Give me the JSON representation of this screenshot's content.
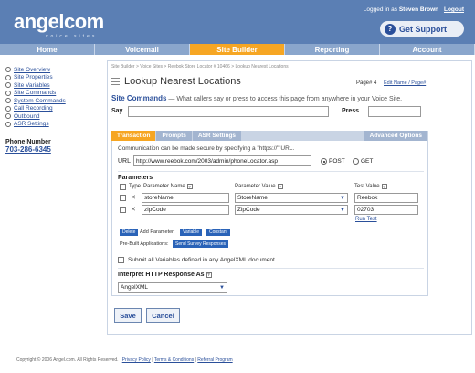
{
  "header": {
    "logo": "angelcom",
    "logo_sub": "voice sites",
    "logged_prefix": "Logged in as",
    "user": "Steven Brown",
    "logout": "Logout",
    "support": "Get Support",
    "brand_color": "#5b7fb4",
    "accent_color": "#f6a623"
  },
  "nav": {
    "tabs": [
      {
        "label": "Home"
      },
      {
        "label": "Voicemail"
      },
      {
        "label": "Site Builder"
      },
      {
        "label": "Reporting"
      },
      {
        "label": "Account"
      }
    ],
    "active": "Site Builder"
  },
  "sidebar": {
    "items": [
      {
        "label": "Site Overview"
      },
      {
        "label": "Site Properties"
      },
      {
        "label": "Site Variables"
      },
      {
        "label": "Site Commands"
      },
      {
        "label": "System Commands"
      },
      {
        "label": "Call Recording"
      },
      {
        "label": "Outbound"
      },
      {
        "label": "ASR Settings"
      }
    ],
    "phone_label": "Phone Number",
    "phone": "703-286-6345"
  },
  "main": {
    "breadcrumb": "Site Builder > Voice Sites > Reebok Store Locator # 10466 > Lookup Nearest Locations",
    "title": "Lookup Nearest Locations",
    "page_num": "Page# 4",
    "edit_name": "Edit Name / Page#",
    "site_commands_title": "Site Commands",
    "site_commands_desc": "— What callers say or press to access this page from anywhere in your Voice Site.",
    "say_label": "Say",
    "press_label": "Press",
    "tabs": [
      {
        "label": "Transaction"
      },
      {
        "label": "Prompts"
      },
      {
        "label": "ASR Settings"
      }
    ],
    "advanced_tab": "Advanced Options",
    "secure_note": "Communication can be made secure by specifying a \"https://\" URL.",
    "url_label": "URL",
    "url_value": "http://www.reebok.com/2003/admin/phoneLocator.asp",
    "method_post": "POST",
    "method_get": "GET",
    "params_title": "Parameters",
    "col_type": "Type",
    "col_name": "Parameter Name",
    "col_value": "Parameter Value",
    "col_test": "Test Value",
    "params": [
      {
        "name": "storeName",
        "value": "StoreName",
        "test": "Reebok"
      },
      {
        "name": "zipCode",
        "value": "ZipCode",
        "test": "02703"
      }
    ],
    "run_test": "Run Test",
    "delete_btn": "Delete",
    "add_param_label": "Add Parameter:",
    "variable_btn": "Variable",
    "constant_btn": "Constant",
    "prebuilt_label": "Pre-Built Applications:",
    "survey_btn": "Send Survey Responses",
    "submit_all": "Submit all Variables defined in any AngelXML document",
    "interpret_title": "Interpret HTTP Response As",
    "interpret_value": "AngelXML",
    "save": "Save",
    "cancel": "Cancel"
  },
  "footer": {
    "copyright": "Copyright © 2006 Angel.com. All Rights Reserved.",
    "privacy": "Privacy Policy",
    "terms": "Terms & Conditions",
    "referral": "Referral Program",
    "sep": "|"
  }
}
